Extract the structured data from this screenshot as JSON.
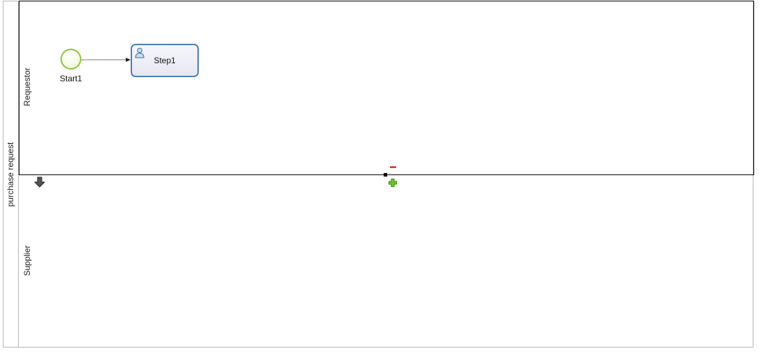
{
  "pool": {
    "label": "purchase request"
  },
  "lanes": [
    {
      "label": "Requestor"
    },
    {
      "label": "Supplier"
    }
  ],
  "nodes": {
    "start": {
      "label": "Start1"
    },
    "task": {
      "label": "Step1"
    }
  },
  "icons": {
    "task_type": "user-icon",
    "lane_controls": [
      "remove-lane-icon",
      "add-lane-icon",
      "move-lane-down-icon"
    ]
  },
  "colors": {
    "start_event_border": "#8cc63f",
    "task_border": "#4a7fb3",
    "remove": "#cc0000",
    "add": "#44bb00"
  }
}
